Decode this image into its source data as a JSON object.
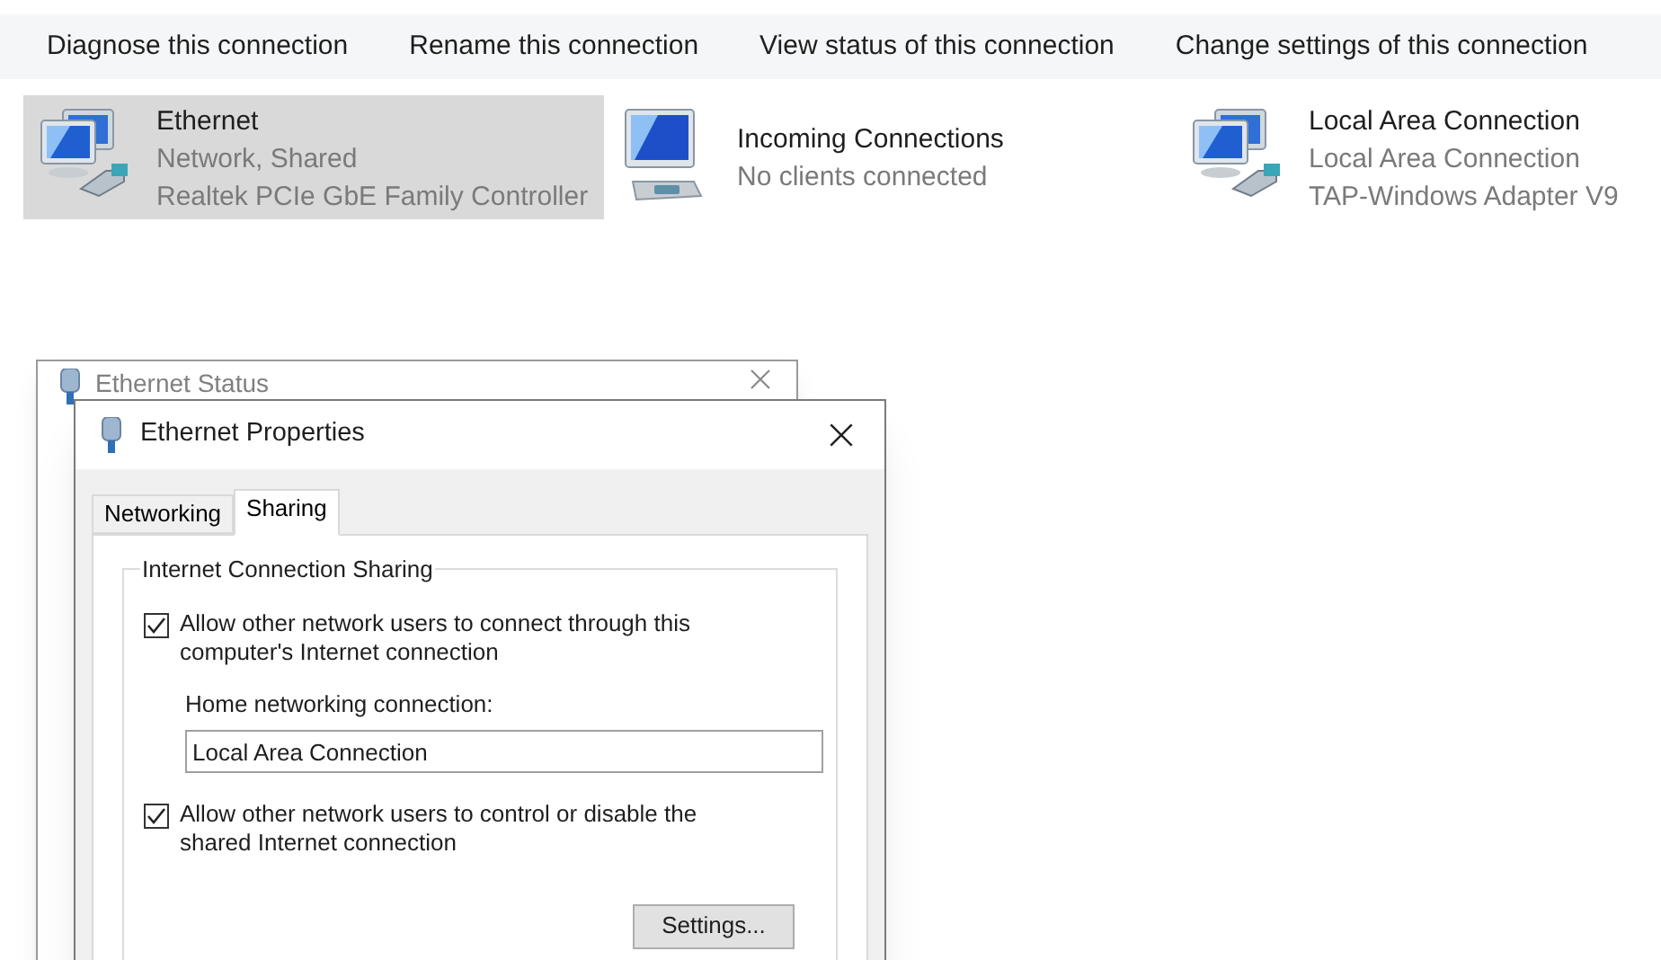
{
  "toolbar": [
    "Diagnose this connection",
    "Rename this connection",
    "View status of this connection",
    "Change settings of this connection"
  ],
  "connections": [
    {
      "name": "Ethernet",
      "status": "Network, Shared",
      "device": "Realtek PCIe GbE Family Controller",
      "kind": "adapter",
      "selected": true
    },
    {
      "name": "Incoming Connections",
      "status": "No clients connected",
      "kind": "incoming",
      "selected": false
    },
    {
      "name": "Local Area Connection",
      "status": "Local Area Connection",
      "device": "TAP-Windows Adapter V9",
      "kind": "adapter",
      "selected": false
    }
  ],
  "back_window": {
    "title": "Ethernet Status"
  },
  "dialog": {
    "title": "Ethernet Properties",
    "tabs": [
      {
        "label": "Networking",
        "selected": false
      },
      {
        "label": "Sharing",
        "selected": true
      }
    ],
    "group_title": "Internet Connection Sharing",
    "options": [
      {
        "label": "Allow other network users to connect through this computer's Internet connection",
        "checked": true
      },
      {
        "label": "Allow other network users to control or disable the shared Internet connection",
        "checked": true
      }
    ],
    "home_label": "Home networking connection:",
    "home_value": "Local Area Connection",
    "settings_button": "Settings..."
  }
}
